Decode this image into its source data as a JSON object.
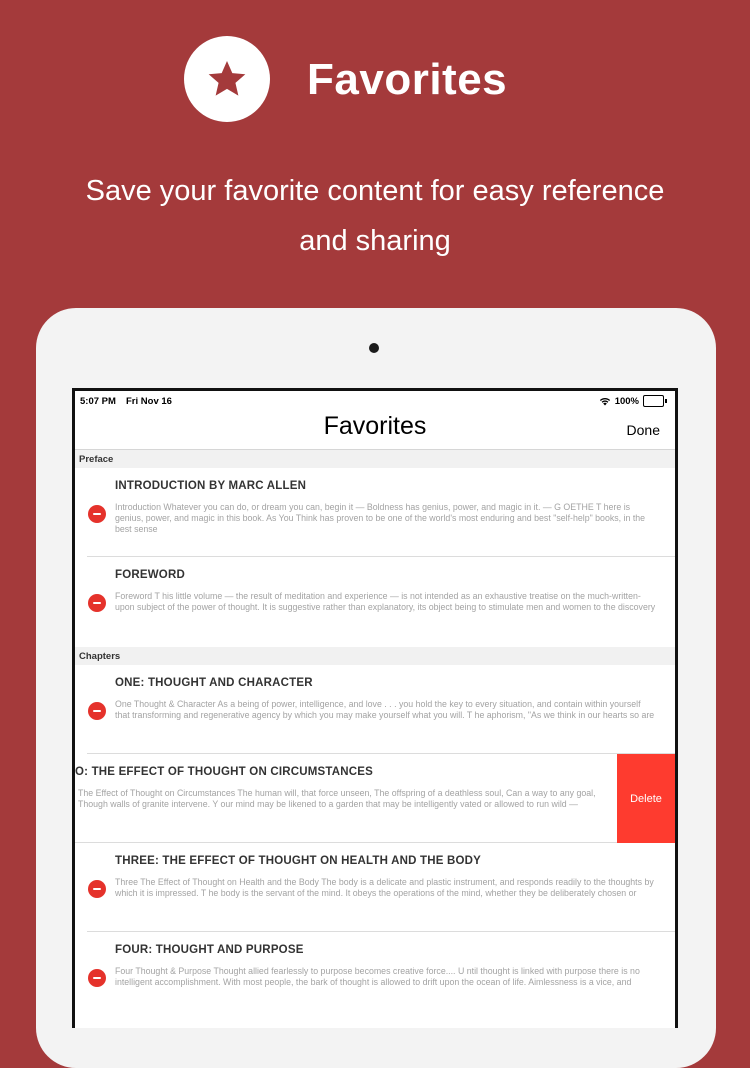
{
  "promo": {
    "icon": "star-icon",
    "title": "Favorites",
    "subtitle_line1": "Save your favorite content for easy reference",
    "subtitle_line2": "and sharing"
  },
  "status_bar": {
    "time": "5:07 PM",
    "date": "Fri Nov 16",
    "battery_percent": "100%",
    "battery_level": 1.0
  },
  "nav": {
    "title": "Favorites",
    "done_label": "Done"
  },
  "sections": {
    "preface": "Preface",
    "chapters": "Chapters"
  },
  "rows": [
    {
      "title": "INTRODUCTION BY MARC ALLEN",
      "excerpt": "Introduction   Whatever you can do, or dream you can, begin it — Boldness has genius, power, and magic in it.  — G OETHE  T here is genius, power, and magic in this book. As You Think has proven to be one of the world's most enduring and best \"self-help\" books, in the best sense"
    },
    {
      "title": "FOREWORD",
      "excerpt": "Foreword   T his little volume — the result of meditation and experience — is not intended as an exhaustive treatise on the much-written-upon subject of the power of thought. It is suggestive rather than explanatory, its object being to stimulate men and women to the discovery"
    },
    {
      "title": "ONE: THOUGHT AND CHARACTER",
      "excerpt": "One Thought & Character   As a being of power, intelligence, and love . . . you hold the key to every situation, and contain within yourself that transforming and regenerative agency by which you may make yourself what you will.   T he aphorism, \"As we think in our hearts so are"
    },
    {
      "title": "O: THE EFFECT OF THOUGHT ON CIRCUMSTANCES",
      "excerpt": "The Effect of Thought on Circumstances   The human will, that force unseen, The offspring of a deathless soul, Can a way to any goal, Though walls of granite intervene.    Y our mind may be likened to a garden that may be intelligently vated or allowed to run wild —",
      "delete_label": "Delete"
    },
    {
      "title": "THREE: THE EFFECT OF THOUGHT ON HEALTH AND THE BODY",
      "excerpt": "Three The Effect of Thought on Health and the Body   The body is a delicate and plastic instrument, and responds readily to the thoughts by which it is impressed.   T he body is the servant of the mind. It obeys the operations of the mind, whether they be deliberately chosen or"
    },
    {
      "title": "FOUR: THOUGHT AND PURPOSE",
      "excerpt": "Four Thought & Purpose   Thought allied fearlessly to purpose becomes creative force....   U ntil thought is linked with purpose there is no intelligent accomplishment. With most people, the bark of thought is allowed to drift upon the ocean of life. Aimlessness is a vice, and"
    }
  ],
  "colors": {
    "background": "#a43a3b",
    "delete": "#fe3b2f",
    "minus": "#e5322b"
  }
}
